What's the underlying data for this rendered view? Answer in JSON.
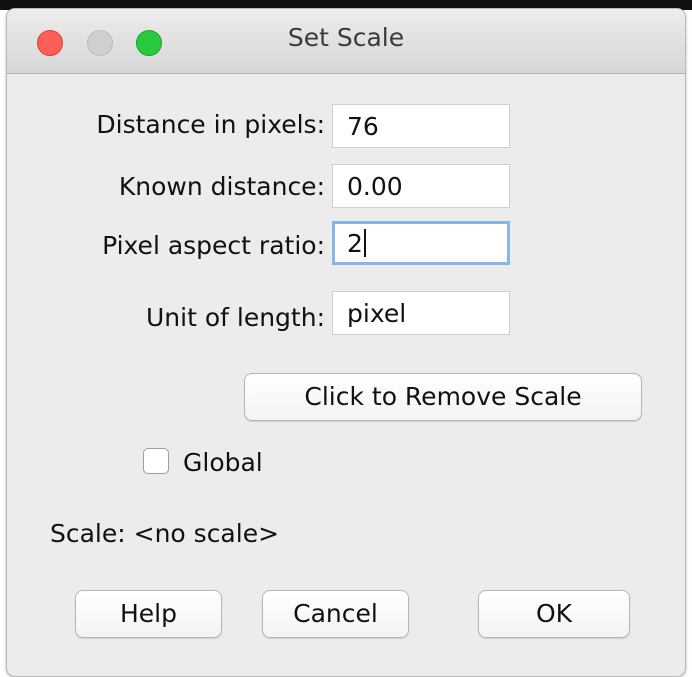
{
  "window": {
    "title": "Set Scale"
  },
  "form": {
    "distance_in_pixels": {
      "label": "Distance in pixels:",
      "value": "76"
    },
    "known_distance": {
      "label": "Known distance:",
      "value": "0.00"
    },
    "pixel_aspect_ratio": {
      "label": "Pixel aspect ratio:",
      "value": "2"
    },
    "unit_of_length": {
      "label": "Unit of length:",
      "value": "pixel"
    }
  },
  "remove_scale_label": "Click to Remove Scale",
  "global": {
    "label": "Global",
    "checked": false
  },
  "scale_status": "Scale: <no scale>",
  "buttons": {
    "help": "Help",
    "cancel": "Cancel",
    "ok": "OK"
  },
  "colors": {
    "close": "#fc5f57",
    "minimize": "#cfcfcf",
    "zoom": "#2ac93e",
    "focus_ring": "#86b6ea",
    "window_bg": "#ececec"
  }
}
